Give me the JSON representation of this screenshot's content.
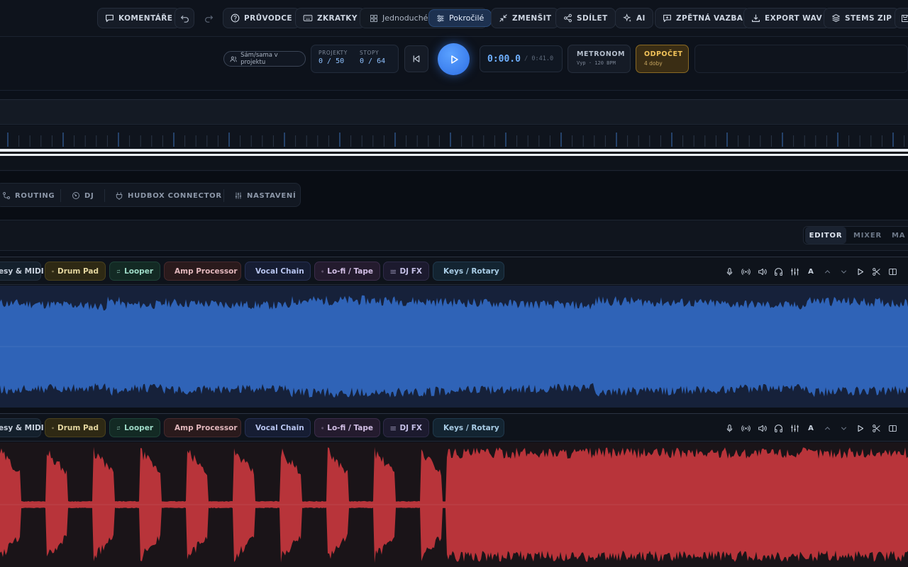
{
  "toolbar": {
    "comments": "KOMENTÁŘE",
    "guide": "PRŮVODCE",
    "shortcuts": "ZKRATKY",
    "simple": "Jednoduché",
    "advanced": "Pokročilé",
    "shrink": "ZMENŠIT",
    "share": "SDÍLET",
    "ai": "AI",
    "feedback": "ZPĚTNÁ VAZBA",
    "export_wav": "EXPORT WAV",
    "stems_zip": "STEMS ZIP"
  },
  "transport": {
    "collab_label": "Sám/sama v projektu",
    "projects_label": "PROJEKTY",
    "projects_value": "0 / 50",
    "tracks_label": "STOPY",
    "tracks_value": "0 / 64",
    "current_time": "0:00.0",
    "time_separator": "/",
    "total_time": "0:41.0",
    "metronome_title": "METRONOM",
    "metronome_status": "Vyp · 120 BPM",
    "countin_title": "ODPOČET",
    "countin_value": "4 doby"
  },
  "modules": {
    "routing": "ROUTING",
    "dj": "DJ",
    "hudbox": "HUDBOX CONNECTOR",
    "settings": "NASTAVENÍ"
  },
  "views": {
    "editor": "EDITOR",
    "mixer": "MIXER",
    "third": "MA"
  },
  "tracks": [
    {
      "color": "#2f63b7",
      "chips": {
        "keys_midi": "esy & MIDI",
        "drum_pad": "Drum Pad",
        "looper": "Looper",
        "amp": "Amp Processor",
        "vocal": "Vocal Chain",
        "lofi": "Lo-fi / Tape",
        "djfx": "DJ FX",
        "keys_rotary": "Keys / Rotary"
      },
      "auto_label": "A"
    },
    {
      "color": "#b8343a",
      "chips": {
        "keys_midi": "esy & MIDI",
        "drum_pad": "Drum Pad",
        "looper": "Looper",
        "amp": "Amp Processor",
        "vocal": "Vocal Chain",
        "lofi": "Lo-fi / Tape",
        "djfx": "DJ FX",
        "keys_rotary": "Keys / Rotary"
      },
      "auto_label": "A"
    }
  ]
}
